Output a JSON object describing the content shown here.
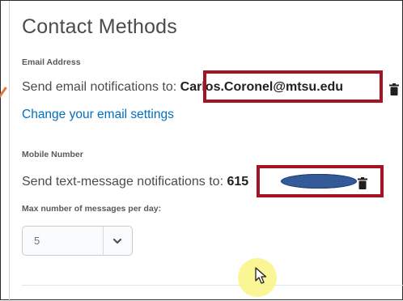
{
  "page": {
    "title": "Contact Methods"
  },
  "email": {
    "label": "Email Address",
    "prefix": "Send email notifications to: ",
    "address": "Carlos.Coronel@mtsu.edu",
    "change_link": "Change your email settings",
    "delete_icon": "trash-icon"
  },
  "mobile": {
    "label": "Mobile Number",
    "prefix": "Send text-message notifications to: ",
    "number_visible": "615",
    "delete_icon": "trash-icon"
  },
  "messages": {
    "label": "Max number of messages per day:",
    "selected": "5",
    "dropdown_icon": "chevron-down-icon"
  },
  "colors": {
    "highlight_box": "#a31424",
    "link": "#006fbf",
    "redaction": "#345a9a",
    "cursor_halo": "#faf482"
  }
}
